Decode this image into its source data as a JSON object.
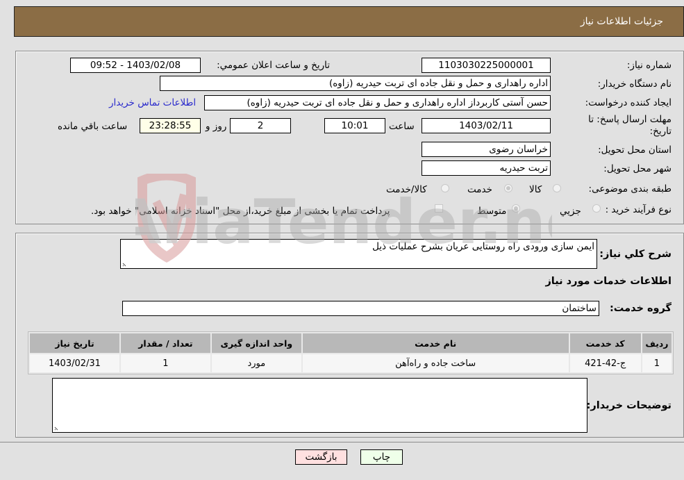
{
  "header": {
    "title": "جزئیات اطلاعات نیاز"
  },
  "fields": {
    "need_number": {
      "label": "شماره نیاز:",
      "value": "1103030225000001"
    },
    "announce_datetime": {
      "label": "تاریخ و ساعت اعلان عمومي:",
      "value": "1403/02/08 - 09:52"
    },
    "buyer_org": {
      "label": "نام دستگاه خریدار:",
      "value": "اداره راهداری و حمل و نقل جاده ای تربت حیدریه (زاوه)"
    },
    "requester": {
      "label": "ایجاد کننده درخواست:",
      "value": "حسن آستی کاربرداز اداره راهداری و حمل و نقل جاده ای تربت حیدریه (زاوه)"
    },
    "buyer_contact_link": "اطلاعات تماس خریدار",
    "deadline": {
      "label": "مهلت ارسال پاسخ: تا تاریخ:",
      "date": "1403/02/11",
      "time_label": "ساعت",
      "time": "10:01",
      "days": "2",
      "days_label": "روز و",
      "remaining": "23:28:55",
      "remaining_label": "ساعت باقي مانده"
    },
    "province": {
      "label": "استان محل تحویل:",
      "value": "خراسان رضوی"
    },
    "city": {
      "label": "شهر محل تحویل:",
      "value": "تربت حیدریه"
    },
    "category": {
      "label": "طبقه بندی موضوعی:",
      "options": [
        "کالا",
        "خدمت",
        "کالا/خدمت"
      ],
      "selected": "خدمت"
    },
    "purchase_type": {
      "label": "نوع فرآیند خرید :",
      "options": [
        "جزيي",
        "متوسط"
      ],
      "selected": "متوسط",
      "treasury_note": "پرداخت تمام یا بخشی از مبلغ خرید،از محل \"اسناد خزانه اسلامی\" خواهد بود."
    }
  },
  "description": {
    "label": "شرح کلي نیاز:",
    "value": "ایمن سازی ورودی راه روستایی عریان بشرح عملیات ذیل"
  },
  "services_section": {
    "title": "اطلاعات خدمات مورد نیاز",
    "group_label": "گروه خدمت:",
    "group_value": "ساختمان",
    "table": {
      "headers": [
        "ردیف",
        "کد خدمت",
        "نام خدمت",
        "واحد اندازه گیری",
        "تعداد / مقدار",
        "تاریخ نیاز"
      ],
      "rows": [
        [
          "1",
          "ج-42-421",
          "ساخت جاده و راه‌آهن",
          "مورد",
          "1",
          "1403/02/31"
        ]
      ]
    }
  },
  "buyer_notes": {
    "label": "توضیحات خریدار:",
    "value": ""
  },
  "buttons": {
    "print": "چاپ",
    "back": "بازگشت"
  },
  "watermark": {
    "text": "AriaTender.neT"
  }
}
